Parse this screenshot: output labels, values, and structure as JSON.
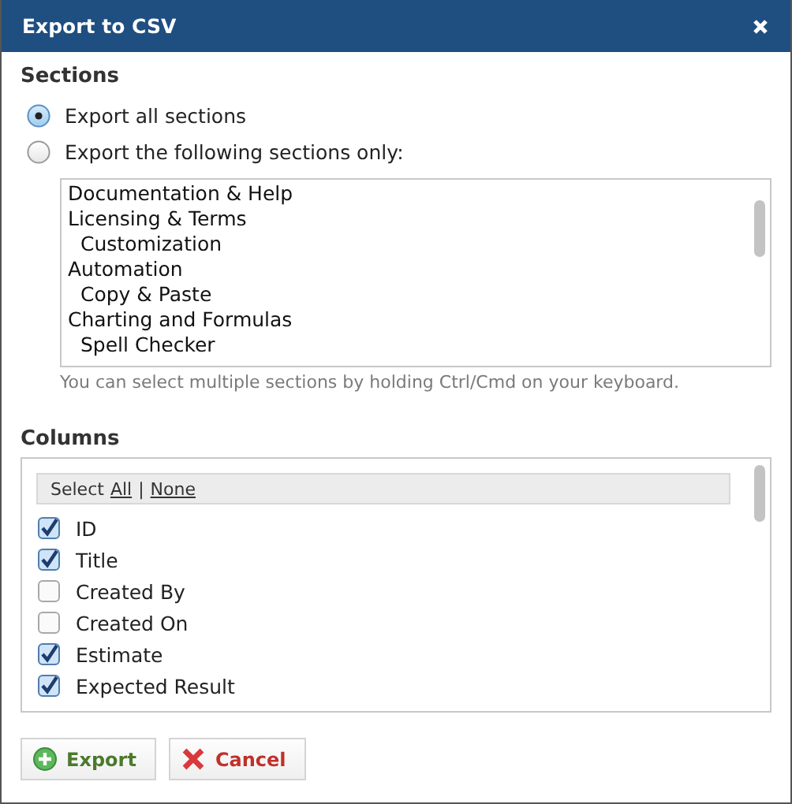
{
  "window": {
    "title": "Export to CSV"
  },
  "sections": {
    "heading": "Sections",
    "options": [
      {
        "label": "Export all sections",
        "selected": true
      },
      {
        "label": "Export the following sections only:",
        "selected": false
      }
    ],
    "list": [
      {
        "label": "Documentation & Help"
      },
      {
        "label": "Licensing & Terms",
        "children": [
          {
            "label": "Customization"
          }
        ]
      },
      {
        "label": "Automation",
        "children": [
          {
            "label": "Copy & Paste"
          }
        ]
      },
      {
        "label": "Charting and Formulas",
        "children": [
          {
            "label": "Spell Checker"
          }
        ]
      }
    ],
    "hint": "You can select multiple sections by holding Ctrl/Cmd on your keyboard."
  },
  "columns": {
    "heading": "Columns",
    "select_label": "Select",
    "all_link": "All",
    "separator": "|",
    "none_link": "None",
    "items": [
      {
        "label": "ID",
        "checked": true
      },
      {
        "label": "Title",
        "checked": true
      },
      {
        "label": "Created By",
        "checked": false
      },
      {
        "label": "Created On",
        "checked": false
      },
      {
        "label": "Estimate",
        "checked": true
      },
      {
        "label": "Expected Result",
        "checked": true
      }
    ]
  },
  "buttons": [
    {
      "label": "Export",
      "kind": "add"
    },
    {
      "label": "Cancel",
      "kind": "cancel"
    }
  ]
}
